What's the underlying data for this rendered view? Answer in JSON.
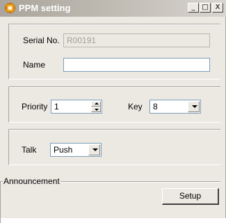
{
  "window": {
    "title": "PPM setting",
    "buttons": {
      "minimize": "_",
      "maximize": "□",
      "close": "X"
    }
  },
  "identity": {
    "serial_label": "Serial No.",
    "serial_value": "R00191",
    "name_label": "Name",
    "name_value": ""
  },
  "priority": {
    "label": "Priority",
    "value": "1"
  },
  "key": {
    "label": "Key",
    "value": "8"
  },
  "talk": {
    "label": "Talk",
    "value": "Push"
  },
  "announcement": {
    "label": "Announcement",
    "setup_button": "Setup"
  },
  "colors": {
    "window_bg": "#ece9e3",
    "title_text": "#ffffff",
    "field_border": "#7f9db9"
  }
}
